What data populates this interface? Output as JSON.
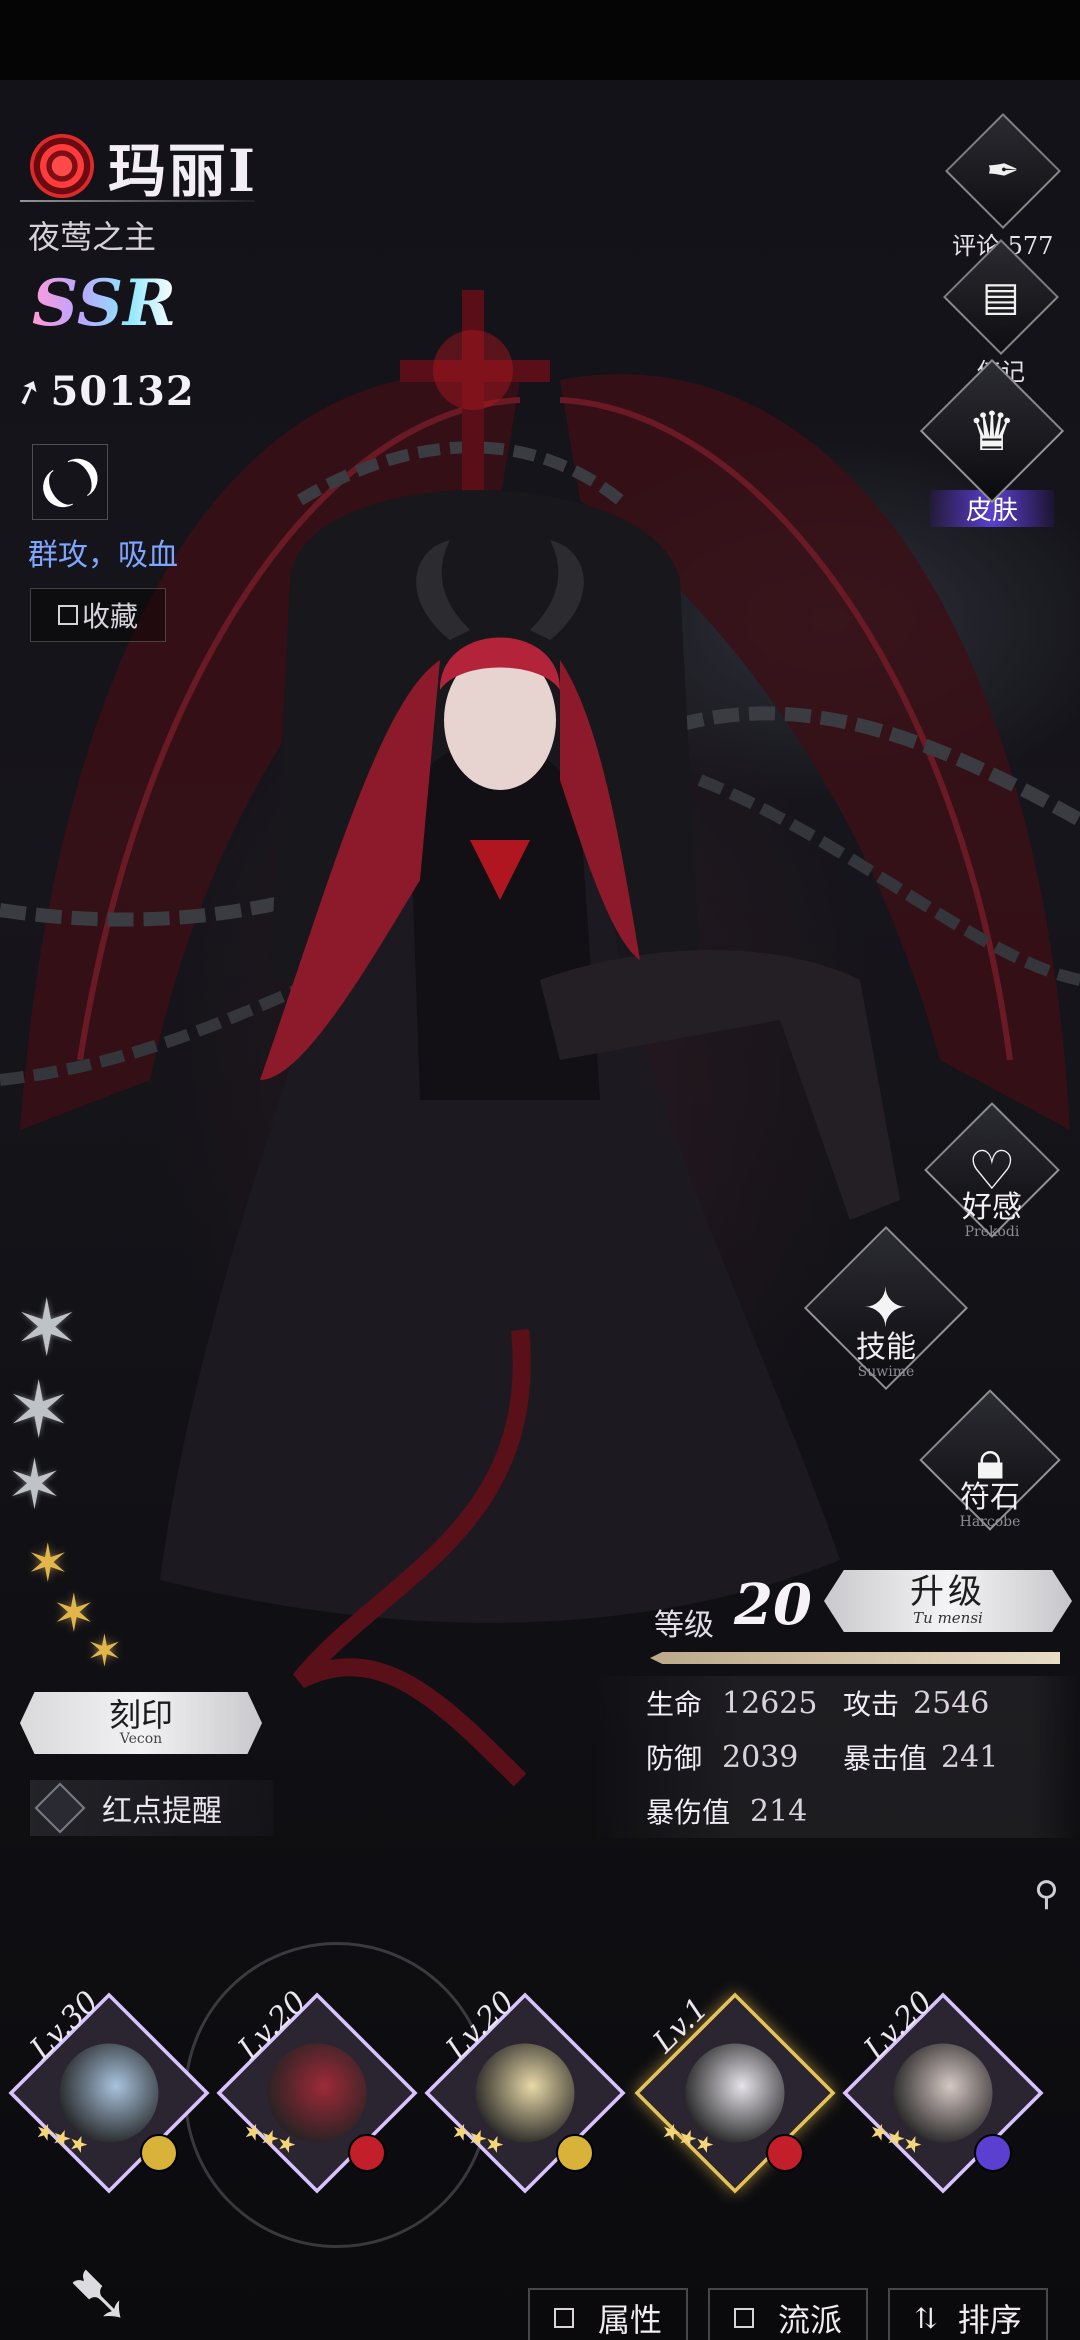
{
  "character": {
    "name": "玛丽I",
    "title": "夜莺之主",
    "rarity": "SSR",
    "power": "50132",
    "tags": "群攻，吸血",
    "favorite_label": "收藏"
  },
  "side_menu": {
    "comments_label": "评论 577",
    "biography_label": "传记",
    "skin_label": "皮肤"
  },
  "actions": {
    "affection": {
      "label": "好感",
      "sub": "Prekodi"
    },
    "skills": {
      "label": "技能",
      "sub": "Suwime"
    },
    "runes": {
      "label": "符石",
      "sub": "Harcobe"
    }
  },
  "engrave": {
    "label": "刻印",
    "sub": "Vecon"
  },
  "red_dot_label": "红点提醒",
  "level": {
    "label": "等级",
    "value": "20",
    "upgrade_label": "升级",
    "upgrade_sub": "Tu mensi"
  },
  "stats": {
    "hp_label": "生命",
    "hp": "12625",
    "atk_label": "攻击",
    "atk": "2546",
    "def_label": "防御",
    "def": "2039",
    "crit_label": "暴击值",
    "crit": "241",
    "critdmg_label": "暴伤值",
    "critdmg": "214"
  },
  "roster": [
    {
      "level": "Lv.30",
      "stars": "★★★",
      "frame": "#d9c3ff",
      "face": "#a9c4de",
      "elem": "#d9b23a"
    },
    {
      "level": "Lv.20",
      "stars": "★★★",
      "frame": "#d9c3ff",
      "face": "#9e2a38",
      "elem": "#c21f2a"
    },
    {
      "level": "Lv.20",
      "stars": "★★★",
      "frame": "#d9c3ff",
      "face": "#e8d9a8",
      "elem": "#d9b23a"
    },
    {
      "level": "Lv.1",
      "stars": "★★★",
      "frame": "#e6c25a",
      "face": "#e6e3ea",
      "elem": "#c21f2a"
    },
    {
      "level": "Lv.20",
      "stars": "★★★",
      "frame": "#d9c3ff",
      "face": "#d6c8c4",
      "elem": "#5b3fd0"
    }
  ],
  "bottom": {
    "attribute_label": "属性",
    "school_label": "流派",
    "sort_label": "排序"
  },
  "colors": {
    "accent_purple": "#5b3fd0",
    "tag_blue": "#7fa6ff",
    "fire_red": "#c21f2a",
    "gold_star": "#e2b64a"
  }
}
